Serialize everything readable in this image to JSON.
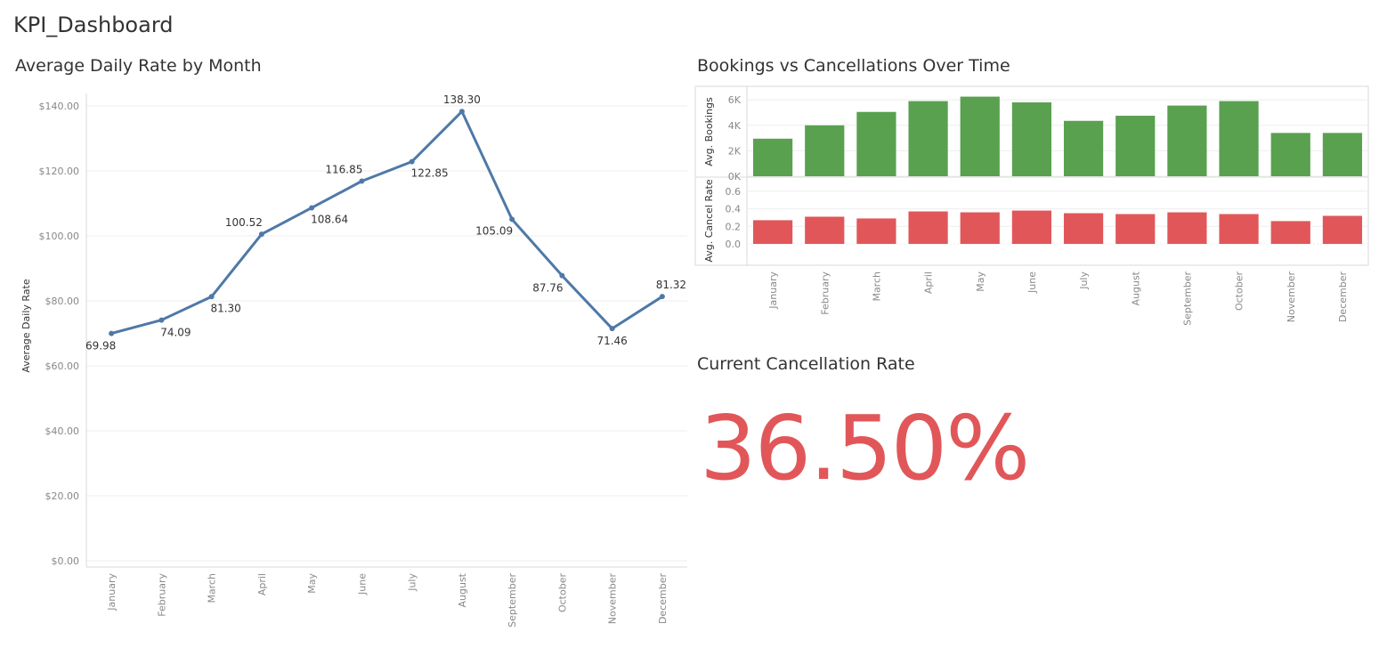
{
  "dashboard_title": "KPI_Dashboard",
  "colors": {
    "line": "#4e79a7",
    "bookings": "#59a14f",
    "cancel": "#e15759",
    "kpi": "#e15759"
  },
  "chart_data": [
    {
      "type": "line",
      "title": "Average Daily Rate by Month",
      "xlabel": "",
      "ylabel": "Average Daily Rate",
      "ylim": [
        0,
        140
      ],
      "yticks": [
        "$0.00",
        "$20.00",
        "$40.00",
        "$60.00",
        "$80.00",
        "$100.00",
        "$120.00",
        "$140.00"
      ],
      "categories": [
        "January",
        "February",
        "March",
        "April",
        "May",
        "June",
        "July",
        "August",
        "September",
        "October",
        "November",
        "December"
      ],
      "values": [
        69.98,
        74.09,
        81.3,
        100.52,
        108.64,
        116.85,
        122.85,
        138.3,
        105.09,
        87.76,
        71.46,
        81.32
      ],
      "labels": [
        "69.98",
        "74.09",
        "81.30",
        "100.52",
        "108.64",
        "116.85",
        "122.85",
        "138.30",
        "105.09",
        "87.76",
        "71.46",
        "81.32"
      ],
      "grid": true
    },
    {
      "type": "bar",
      "title": "Bookings vs Cancellations Over Time",
      "categories": [
        "January",
        "February",
        "March",
        "April",
        "May",
        "June",
        "July",
        "August",
        "September",
        "October",
        "November",
        "December"
      ],
      "panels": [
        {
          "ylabel": "Avg. Bookings",
          "ylim": [
            0,
            6500
          ],
          "yticks": [
            "0K",
            "2K",
            "4K",
            "6K"
          ],
          "values": [
            2950,
            4000,
            5050,
            5900,
            6250,
            5800,
            4350,
            4750,
            5550,
            5900,
            3400,
            3400
          ]
        },
        {
          "ylabel": "Avg. Cancel Rate",
          "ylim": [
            0,
            0.68
          ],
          "yticks": [
            "0.0",
            "0.2",
            "0.4",
            "0.6"
          ],
          "values": [
            0.27,
            0.31,
            0.29,
            0.37,
            0.36,
            0.38,
            0.35,
            0.34,
            0.36,
            0.34,
            0.26,
            0.32
          ]
        }
      ],
      "grid": true
    }
  ],
  "kpi": {
    "title": "Current Cancellation Rate",
    "value": "36.50%"
  }
}
